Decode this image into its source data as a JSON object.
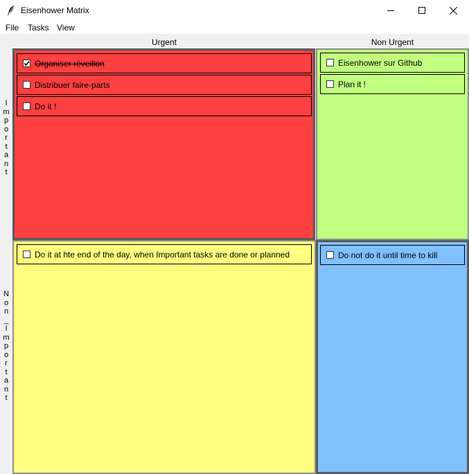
{
  "window": {
    "title": "Eisenhower Matrix"
  },
  "menu": {
    "file": "File",
    "tasks": "Tasks",
    "view": "View"
  },
  "columns": {
    "urgent": "Urgent",
    "non_urgent": "Non Urgent"
  },
  "rows": {
    "important": [
      "I",
      "m",
      "p",
      "o",
      "r",
      "t",
      "a",
      "n",
      "t"
    ],
    "non_important": [
      "N",
      "o",
      "n",
      "_",
      "I",
      "m",
      "p",
      "o",
      "r",
      "t",
      "a",
      "n",
      "t"
    ]
  },
  "colors": {
    "urgent_important": "#ff4040",
    "nonurgent_important": "#c0ff80",
    "urgent_nonimportant": "#ffff80",
    "nonurgent_nonimportant": "#80c0ff"
  },
  "quadrants": {
    "urgent_important": {
      "tasks": [
        {
          "label": "Organiser réveillon",
          "checked": true
        },
        {
          "label": "Distribuer faire-parts",
          "checked": false
        },
        {
          "label": "Do it !",
          "checked": false
        }
      ]
    },
    "nonurgent_important": {
      "tasks": [
        {
          "label": "Eisenhower sur Github",
          "checked": false
        },
        {
          "label": "Plan it !",
          "checked": false
        }
      ]
    },
    "urgent_nonimportant": {
      "tasks": [
        {
          "label": "Do it at hte end of the day, when Important tasks are done or planned",
          "checked": false
        }
      ]
    },
    "nonurgent_nonimportant": {
      "tasks": [
        {
          "label": "Do not do it until time to kill",
          "checked": false
        }
      ]
    }
  }
}
